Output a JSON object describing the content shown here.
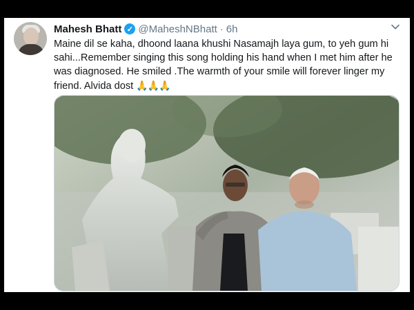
{
  "tweet": {
    "author_name": "Mahesh Bhatt",
    "verified_glyph": "✓",
    "handle": "@MaheshNBhatt",
    "separator": "·",
    "time": "6h",
    "text": "Maine dil se kaha, dhoond laana khushi Nasamajh laya gum, to yeh gum hi sahi...Remember singing this song holding his hand when I met him after he was diagnosed. He smiled .The warmth of your smile will forever linger my friend.  Alvida dost ",
    "emoji": "🙏🙏🙏"
  },
  "icons": {
    "avatar": "user-avatar",
    "verified": "verified-badge-icon",
    "menu": "chevron-down-icon"
  },
  "colors": {
    "accent": "#1da1f2",
    "text_primary": "#14171a",
    "text_secondary": "#657786"
  }
}
